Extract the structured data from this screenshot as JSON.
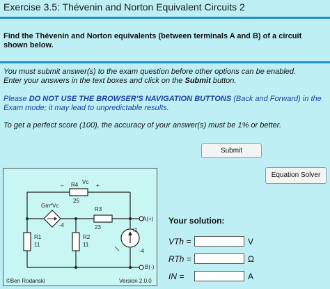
{
  "header": {
    "title": "Exercise 3.5: Thévenin and Norton Equivalent Circuits 2"
  },
  "question": "Find the Thévenin and Norton equivalents (between terminals A and B) of a circuit shown below.",
  "instructions": {
    "line1_a": "You must submit answer(s) to the exam question before other options can be enabled.",
    "line2_a": "Enter your answers in the text boxes and click on the ",
    "line2_b": "Submit",
    "line2_c": " button.",
    "warn_a": "Please ",
    "warn_b": "DO NOT USE THE BROWSER'S NAVIGATION BUTTONS",
    "warn_c": " (Back and Forward) in the Exam mode; it may lead to unpredictable results.",
    "accuracy": "To get a perfect score (100), the accuracy of your answer(s) must be 1% or better."
  },
  "buttons": {
    "submit": "Submit",
    "equation_solver": "Equation Solver"
  },
  "circuit": {
    "r4": "R4",
    "vc": "Vc",
    "minus": "–",
    "plus": "+",
    "r4_val": "25",
    "gm": "Gm*Vc",
    "r3": "R3",
    "gm_val": "-4",
    "r3_val": "23",
    "a_term": "A(+)",
    "b_term": "B(-)",
    "i1": "I1",
    "i1_val": "-4",
    "r1": "R1",
    "r1_val": "11",
    "r2": "R2",
    "r2_val": "11",
    "author": "©Ben Rodanski",
    "version": "Version 2.0.0"
  },
  "solution": {
    "heading": "Your solution:",
    "vth_label": "VTh =",
    "vth_value": "",
    "vth_unit": "V",
    "rth_label": "RTh =",
    "rth_value": "",
    "rth_unit": "Ω",
    "in_label": "IN =",
    "in_value": "",
    "in_unit": "A"
  }
}
